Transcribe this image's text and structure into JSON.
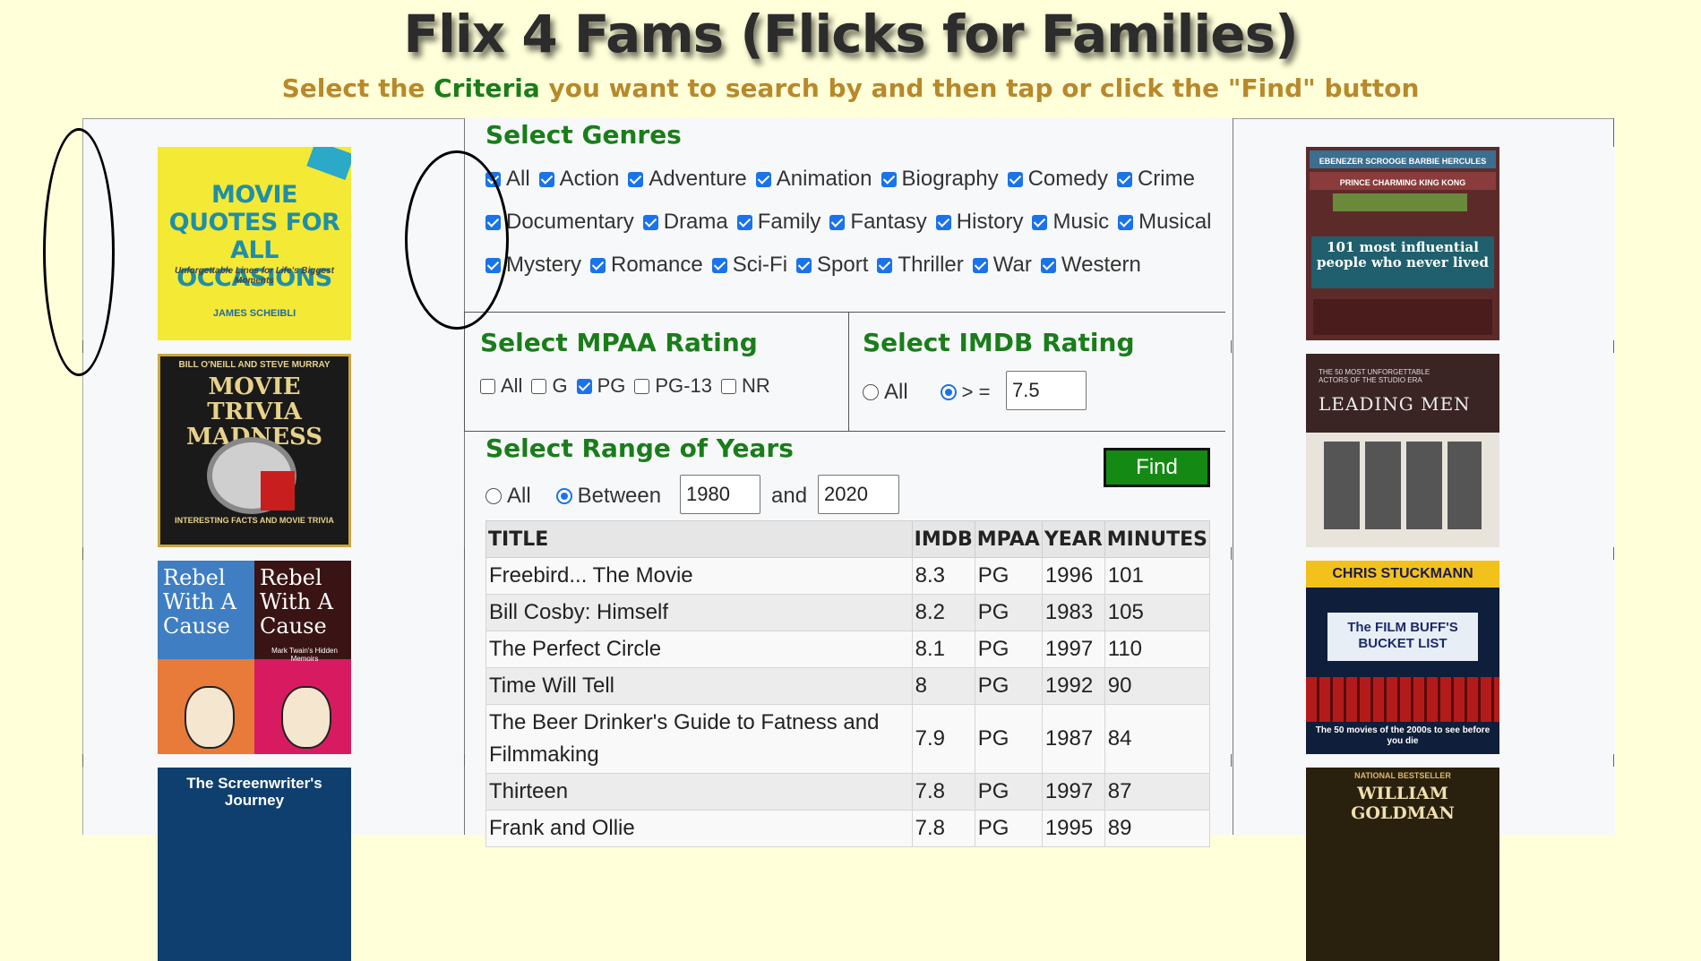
{
  "header": {
    "title": "Flix 4 Fams (Flicks for Families)",
    "subtitle_pre": "Select the ",
    "subtitle_crit": "Criteria",
    "subtitle_post": " you want to search by and then tap or click the \"Find\" button"
  },
  "genres": {
    "title": "Select Genres",
    "rows": [
      [
        "All",
        "Action",
        "Adventure",
        "Animation",
        "Biography",
        "Comedy",
        "Crime"
      ],
      [
        "Documentary",
        "Drama",
        "Family",
        "Fantasy",
        "History",
        "Music",
        "Musical"
      ],
      [
        "Mystery",
        "Romance",
        "Sci-Fi",
        "Sport",
        "Thriller",
        "War",
        "Western"
      ]
    ],
    "checked": true
  },
  "mpaa": {
    "title": "Select MPAA Rating",
    "options": [
      {
        "label": "All",
        "checked": false
      },
      {
        "label": "G",
        "checked": false
      },
      {
        "label": "PG",
        "checked": true
      },
      {
        "label": "PG-13",
        "checked": false
      },
      {
        "label": "NR",
        "checked": false
      }
    ]
  },
  "imdb": {
    "title": "Select IMDB Rating",
    "all_label": "All",
    "gte_label": "> =",
    "selected": "gte",
    "value": "7.5"
  },
  "years": {
    "title": "Select Range of Years",
    "all_label": "All",
    "between_label": "Between",
    "and_label": "and",
    "from": "1980",
    "to": "2020",
    "selected": "between"
  },
  "find_label": "Find",
  "results": {
    "columns": [
      "TITLE",
      "IMDB",
      "MPAA",
      "YEAR",
      "MINUTES"
    ],
    "rows": [
      [
        "Freebird... The Movie",
        "8.3",
        "PG",
        "1996",
        "101"
      ],
      [
        "Bill Cosby: Himself",
        "8.2",
        "PG",
        "1983",
        "105"
      ],
      [
        "The Perfect Circle",
        "8.1",
        "PG",
        "1997",
        "110"
      ],
      [
        "Time Will Tell",
        "8",
        "PG",
        "1992",
        "90"
      ],
      [
        "The Beer Drinker's Guide to Fatness and Filmmaking",
        "7.9",
        "PG",
        "1987",
        "84"
      ],
      [
        "Thirteen",
        "7.8",
        "PG",
        "1997",
        "87"
      ],
      [
        "Frank and Ollie",
        "7.8",
        "PG",
        "1995",
        "89"
      ]
    ]
  },
  "books_left": [
    {
      "title": "MOVIE QUOTES FOR ALL OCCASIONS",
      "subtitle": "Unforgettable Lines for Life's Biggest Moments",
      "author": "JAMES SCHEIBLI"
    },
    {
      "title": "MOVIE TRIVIA MADNESS",
      "subtitle": "INTERESTING FACTS AND MOVIE TRIVIA",
      "author": "BILL O'NEILL AND STEVE MURRAY"
    },
    {
      "title": "Rebel With A Cause",
      "subtitle": "Mark Twain's Hidden Memoirs",
      "author": ""
    },
    {
      "title": "The Screenwriter's Journey",
      "subtitle": "",
      "author": ""
    }
  ],
  "books_right": [
    {
      "title": "101 most influential people who never lived",
      "subtitle": "EBENEZER SCROOGE  BARBIE  HERCULES  PRINCE CHARMING  KING KONG",
      "author": ""
    },
    {
      "title": "LEADING MEN",
      "subtitle": "THE 50 MOST UNFORGETTABLE ACTORS OF THE STUDIO ERA",
      "author": ""
    },
    {
      "title": "The FILM BUFF'S BUCKET LIST",
      "subtitle": "The 50 movies of the 2000s to see before you die",
      "author": "CHRIS STUCKMANN"
    },
    {
      "title": "WILLIAM GOLDMAN",
      "subtitle": "NATIONAL BESTSELLER",
      "author": ""
    }
  ],
  "colors": {
    "accent_green": "#1a7d1a",
    "subtitle_gold": "#b8892a",
    "bg": "#ffffd9",
    "check_blue": "#1a73e8"
  }
}
